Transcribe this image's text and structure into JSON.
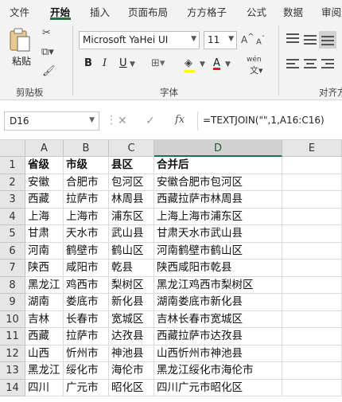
{
  "ribbon": {
    "tabs": [
      "文件",
      "开始",
      "插入",
      "页面布局",
      "方方格子",
      "公式",
      "数据",
      "审阅"
    ],
    "active_tab": "开始",
    "paste_label": "粘贴",
    "clipboard_label": "剪贴板",
    "font_group_label": "字体",
    "align_group_label": "对齐方",
    "font_name": "Microsoft YaHei UI",
    "font_size": "11",
    "bold": "B",
    "italic": "I",
    "underline": "U",
    "grow_font": "A",
    "shrink_font": "A",
    "font_color_glyph": "A",
    "phonetic": "wén"
  },
  "formula_bar": {
    "name_box": "D16",
    "cancel": "✕",
    "enter": "✓",
    "fx": "fx",
    "formula": "=TEXTJOIN(\"\",1,A16:C16)"
  },
  "sheet": {
    "columns": [
      "A",
      "B",
      "C",
      "D",
      "E"
    ],
    "selected_column": "D",
    "row_numbers": [
      "1",
      "2",
      "3",
      "4",
      "5",
      "6",
      "7",
      "8",
      "9",
      "10",
      "11",
      "12",
      "13",
      "14"
    ],
    "rows": [
      [
        "省级",
        "市级",
        "县区",
        "合并后"
      ],
      [
        "安徽",
        "合肥市",
        "包河区",
        "安徽合肥市包河区"
      ],
      [
        "西藏",
        "拉萨市",
        "林周县",
        "西藏拉萨市林周县"
      ],
      [
        "上海",
        "上海市",
        "浦东区",
        "上海上海市浦东区"
      ],
      [
        "甘肃",
        "天水市",
        "武山县",
        "甘肃天水市武山县"
      ],
      [
        "河南",
        "鹤壁市",
        "鹤山区",
        "河南鹤壁市鹤山区"
      ],
      [
        "陕西",
        "咸阳市",
        "乾县",
        "陕西咸阳市乾县"
      ],
      [
        "黑龙江",
        "鸡西市",
        "梨树区",
        "黑龙江鸡西市梨树区"
      ],
      [
        "湖南",
        "娄底市",
        "新化县",
        "湖南娄底市新化县"
      ],
      [
        "吉林",
        "长春市",
        "宽城区",
        "吉林长春市宽城区"
      ],
      [
        "西藏",
        "拉萨市",
        "达孜县",
        "西藏拉萨市达孜县"
      ],
      [
        "山西",
        "忻州市",
        "神池县",
        "山西忻州市神池县"
      ],
      [
        "黑龙江",
        "绥化市",
        "海伦市",
        "黑龙江绥化市海伦市"
      ],
      [
        "四川",
        "广元市",
        "昭化区",
        "四川广元市昭化区"
      ]
    ]
  },
  "colors": {
    "accent": "#217346",
    "header_bg": "#e6e6e6",
    "selected_header": "#d2d2d2"
  }
}
